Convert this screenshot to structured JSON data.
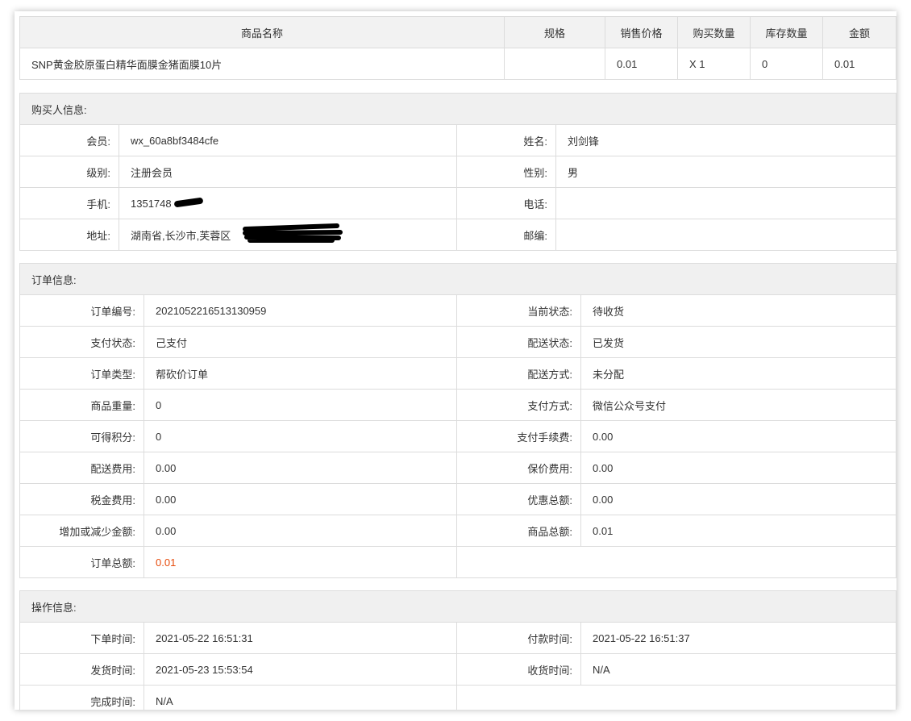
{
  "product_table": {
    "headers": [
      "商品名称",
      "规格",
      "销售价格",
      "购买数量",
      "库存数量",
      "金额"
    ],
    "rows": [
      {
        "name": "SNP黄金胶原蛋白精华面膜金猪面膜10片",
        "spec": "",
        "price": "0.01",
        "qty": "X 1",
        "stock": "0",
        "amount": "0.01"
      }
    ]
  },
  "buyer": {
    "title": "购买人信息:",
    "member_label": "会员:",
    "member_value": "wx_60a8bf3484cfe",
    "name_label": "姓名:",
    "name_value": "刘剑锋",
    "level_label": "级别:",
    "level_value": "注册会员",
    "gender_label": "性别:",
    "gender_value": "男",
    "mobile_label": "手机:",
    "mobile_value": "1351748",
    "phone_label": "电话:",
    "phone_value": "",
    "address_label": "地址:",
    "address_value": "湖南省,长沙市,芙蓉区",
    "zip_label": "邮编:",
    "zip_value": ""
  },
  "order": {
    "title": "订单信息:",
    "rows": [
      {
        "l1": "订单编号:",
        "v1": "2021052216513130959",
        "l2": "当前状态:",
        "v2": "待收货"
      },
      {
        "l1": "支付状态:",
        "v1": "己支付",
        "l2": "配送状态:",
        "v2": "已发货"
      },
      {
        "l1": "订单类型:",
        "v1": "帮砍价订单",
        "l2": "配送方式:",
        "v2": "未分配"
      },
      {
        "l1": "商品重量:",
        "v1": "0",
        "l2": "支付方式:",
        "v2": "微信公众号支付"
      },
      {
        "l1": "可得积分:",
        "v1": "0",
        "l2": "支付手续费:",
        "v2": "0.00"
      },
      {
        "l1": "配送费用:",
        "v1": "0.00",
        "l2": "保价费用:",
        "v2": "0.00"
      },
      {
        "l1": "税金费用:",
        "v1": "0.00",
        "l2": "优惠总额:",
        "v2": "0.00"
      },
      {
        "l1": "增加或减少金额:",
        "v1": "0.00",
        "l2": "商品总额:",
        "v2": "0.01"
      }
    ],
    "total_label": "订单总额:",
    "total_value": "0.01",
    "total_color": "#e64a0b"
  },
  "operation": {
    "title": "操作信息:",
    "order_time_label": "下单时间:",
    "order_time_value": "2021-05-22 16:51:31",
    "pay_time_label": "付款时间:",
    "pay_time_value": "2021-05-22 16:51:37",
    "ship_time_label": "发货时间:",
    "ship_time_value": "2021-05-23 15:53:54",
    "receive_time_label": "收货时间:",
    "receive_time_value": "N/A",
    "complete_time_label": "完成时间:",
    "complete_time_value": "N/A"
  }
}
